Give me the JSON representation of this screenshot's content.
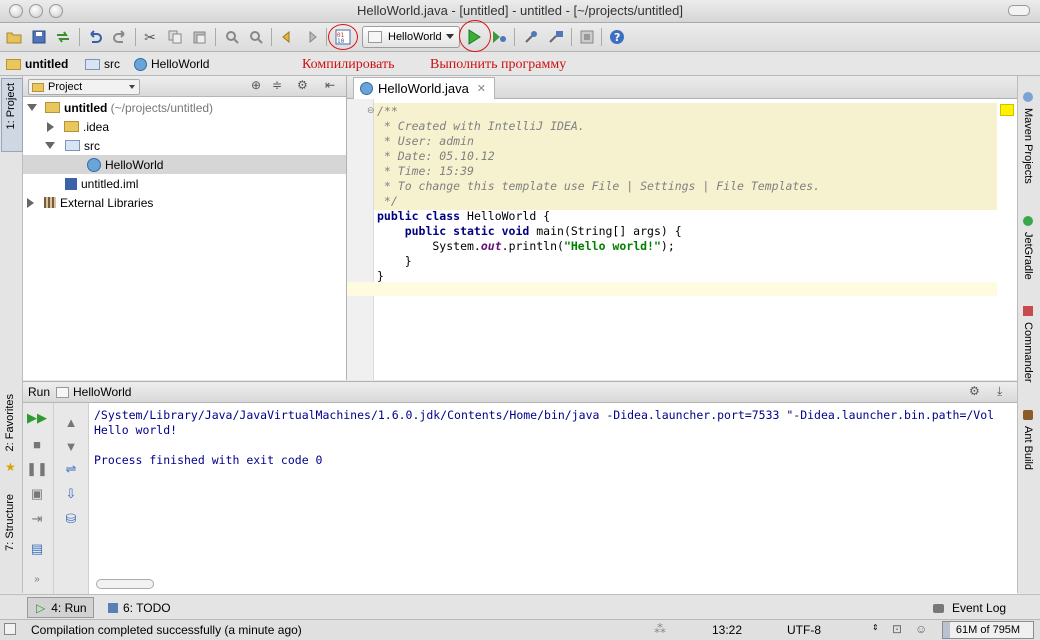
{
  "window": {
    "title": "HelloWorld.java - [untitled] - untitled - [~/projects/untitled]"
  },
  "toolbar": {
    "run_config": "HelloWorld",
    "icons": [
      "open-icon",
      "save-icon",
      "sync-icon",
      "undo-icon",
      "redo-icon",
      "cut-icon",
      "copy-icon",
      "paste-icon",
      "find-icon",
      "replace-icon",
      "back-icon",
      "forward-icon",
      "make-icon",
      "run-icon",
      "debug-icon",
      "settings-icon",
      "structure-icon",
      "sdk-icon",
      "help-icon"
    ]
  },
  "annotations": {
    "compile": "Компилировать",
    "run": "Выполнить программу"
  },
  "navbar": {
    "crumbs": [
      "untitled",
      "src",
      "HelloWorld"
    ]
  },
  "tool_windows": {
    "left": [
      "1: Project",
      "2: Favorites",
      "7: Structure"
    ],
    "right": [
      "Maven Projects",
      "JetGradle",
      "Commander",
      "Ant Build"
    ]
  },
  "project": {
    "header": "Project",
    "tree": [
      {
        "label": "untitled",
        "suffix": "(~/projects/untitled)"
      },
      {
        "label": ".idea"
      },
      {
        "label": "src"
      },
      {
        "label": "HelloWorld"
      },
      {
        "label": "untitled.iml"
      },
      {
        "label": "External Libraries"
      }
    ]
  },
  "editor": {
    "tab": "HelloWorld.java",
    "lines": [
      {
        "cmt": "/**"
      },
      {
        "cmt": " * Created with IntelliJ IDEA."
      },
      {
        "cmt": " * User: admin"
      },
      {
        "cmt": " * Date: 05.10.12"
      },
      {
        "cmt": " * Time: 15:39"
      },
      {
        "cmt": " * To change this template use File | Settings | File Templates."
      },
      {
        "cmt": " */"
      }
    ],
    "code": {
      "l8_kw": "public class",
      "l8_rest": " HelloWorld {",
      "l9_kw": "    public static void",
      "l9_rest": " main(String[] args) {",
      "l10_a": "        System.",
      "l10_field": "out",
      "l10_b": ".println(",
      "l10_str": "\"Hello world!\"",
      "l10_c": ");",
      "l11": "    }",
      "l12": "}"
    }
  },
  "run_panel": {
    "title": "Run",
    "config": "HelloWorld",
    "output": [
      "/System/Library/Java/JavaVirtualMachines/1.6.0.jdk/Contents/Home/bin/java -Didea.launcher.port=7533 \"-Didea.launcher.bin.path=/Vol",
      "Hello world!",
      "",
      "Process finished with exit code 0"
    ]
  },
  "bottom_tabs": {
    "run": "4: Run",
    "todo": "6: TODO",
    "event_log": "Event Log"
  },
  "status": {
    "message": "Compilation completed successfully (a minute ago)",
    "time": "13:22",
    "encoding": "UTF-8",
    "memory": "61M of 795M"
  }
}
